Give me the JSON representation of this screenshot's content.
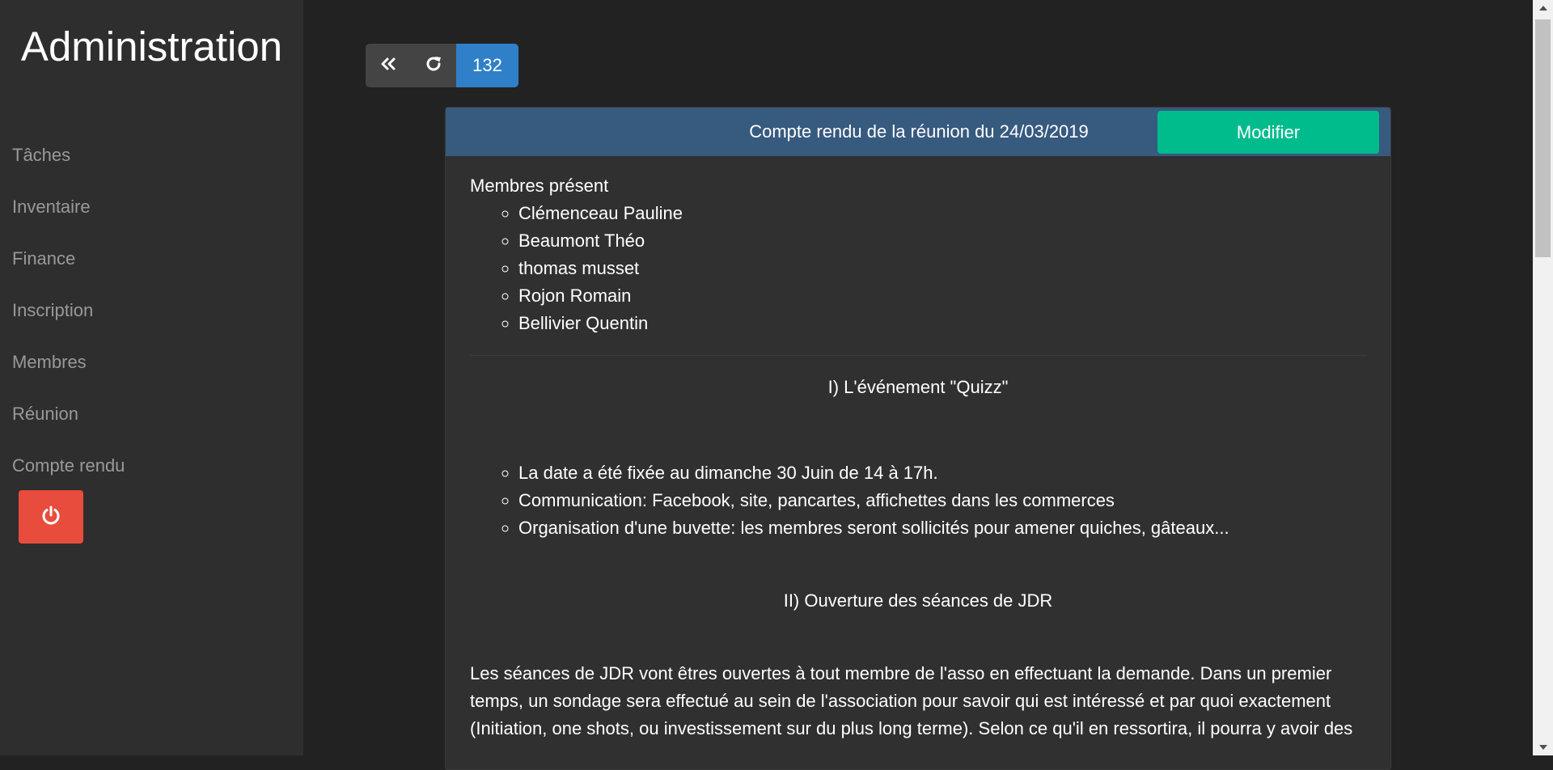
{
  "sidebar": {
    "title": "Administration",
    "items": [
      {
        "label": "Tâches"
      },
      {
        "label": "Inventaire"
      },
      {
        "label": "Finance"
      },
      {
        "label": "Inscription"
      },
      {
        "label": "Membres"
      },
      {
        "label": "Réunion"
      },
      {
        "label": "Compte rendu"
      }
    ],
    "logout_icon": "power-icon"
  },
  "toolbar": {
    "back_icon": "double-chevron-left-icon",
    "refresh_icon": "refresh-icon",
    "count": "132"
  },
  "report": {
    "title": "Compte rendu de la réunion du 24/03/2019",
    "modify_label": "Modifier",
    "members_label": "Membres présent",
    "members": [
      "Clémenceau Pauline",
      "Beaumont Théo",
      "thomas musset",
      "Rojon Romain",
      "Bellivier Quentin"
    ],
    "section1_title": "I) L'événement \"Quizz\"",
    "section1_items": [
      "La date a été fixée au dimanche 30 Juin de 14 à 17h.",
      "Communication: Facebook, site, pancartes, affichettes dans les commerces",
      "Organisation d'une buvette: les membres seront sollicités pour amener quiches, gâteaux..."
    ],
    "section2_title": "II) Ouverture des séances de JDR",
    "section2_paragraph": "Les séances de JDR vont êtres ouvertes à tout membre de l'asso en effectuant la demande. Dans un premier temps, un sondage sera effectué au sein de l'association pour savoir qui est intéressé et par quoi exactement (Initiation, one shots, ou investissement sur du plus long terme). Selon ce qu'il en ressortira, il pourra y avoir des"
  },
  "colors": {
    "background": "#222222",
    "sidebar": "#2e2e2e",
    "card_header": "#375a7f",
    "modify_button": "#00bc8c",
    "count_badge": "#2f80c8",
    "logout_button": "#e74c3c"
  }
}
